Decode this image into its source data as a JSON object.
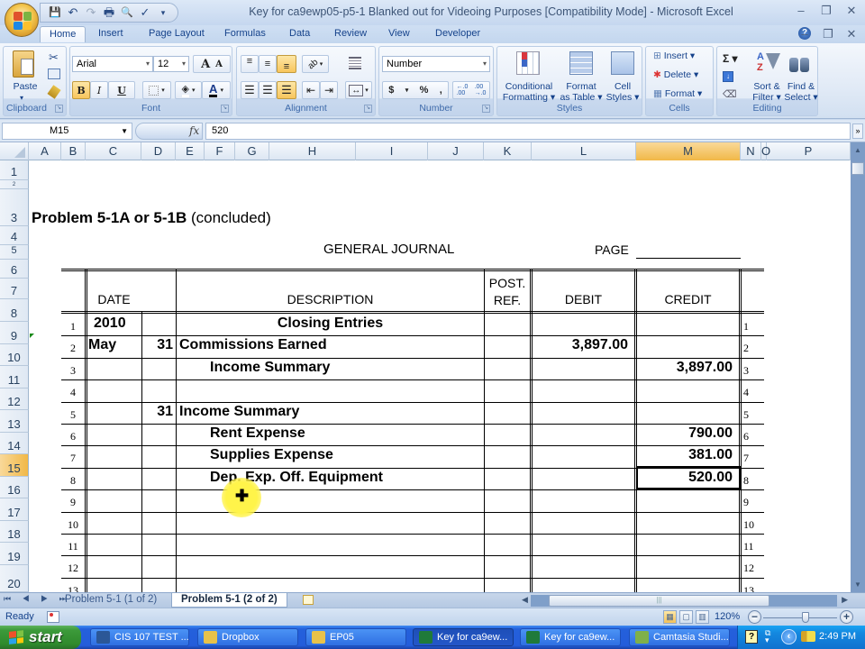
{
  "window": {
    "title": "Key for ca9ewp05-p5-1 Blanked out for Videoing Purposes  [Compatibility Mode] - Microsoft Excel",
    "minimize": "–",
    "restore": "❐",
    "close": "✕"
  },
  "quick_access": {
    "save": "💾",
    "undo": "↶",
    "redo": "↷",
    "print": "🖶",
    "preview": "🔍",
    "spelling": "✓",
    "customize": "▾"
  },
  "tabs": [
    {
      "label": "Home",
      "active": true
    },
    {
      "label": "Insert"
    },
    {
      "label": "Page Layout"
    },
    {
      "label": "Formulas"
    },
    {
      "label": "Data"
    },
    {
      "label": "Review"
    },
    {
      "label": "View"
    },
    {
      "label": "Developer"
    }
  ],
  "ribbon": {
    "clipboard": {
      "label": "Clipboard",
      "paste": "Paste"
    },
    "font": {
      "label": "Font",
      "name": "Arial",
      "size": "12",
      "bold": "B",
      "italic": "I",
      "underline": "U",
      "grow": "A",
      "shrink": "A"
    },
    "alignment": {
      "label": "Alignment"
    },
    "number": {
      "label": "Number",
      "format": "Number",
      "currency": "$",
      "percent": "%",
      "comma": ",",
      "inc_decimal": "←.0 .00",
      "dec_decimal": ".00 →.0"
    },
    "styles": {
      "label": "Styles",
      "conditional_1": "Conditional",
      "conditional_2": "Formatting ▾",
      "format_table_1": "Format",
      "format_table_2": "as Table ▾",
      "cell_styles_1": "Cell",
      "cell_styles_2": "Styles ▾"
    },
    "cells": {
      "label": "Cells",
      "insert": "Insert ▾",
      "delete": "Delete ▾",
      "format": "Format ▾"
    },
    "editing": {
      "label": "Editing",
      "sum": "Σ ▾",
      "sort_1": "Sort &",
      "sort_2": "Filter ▾",
      "find_1": "Find &",
      "find_2": "Select ▾"
    }
  },
  "formula_bar": {
    "name_box": "M15",
    "fx": "fx",
    "value": "520"
  },
  "columns": [
    "A",
    "B",
    "C",
    "D",
    "E",
    "F",
    "G",
    "H",
    "I",
    "J",
    "K",
    "L",
    "M",
    "N",
    "O",
    "P"
  ],
  "selected_column": "M",
  "rows": [
    "1",
    "2",
    "3",
    "4",
    "5",
    "6",
    "7",
    "8",
    "9",
    "10",
    "11",
    "12",
    "13",
    "14",
    "15",
    "16",
    "17",
    "18",
    "19",
    "20"
  ],
  "selected_row": "15",
  "sheet": {
    "title_bold": "Problem 5-1A or 5-1B",
    "title_rest": " (concluded)",
    "journal_title": "GENERAL JOURNAL",
    "page_label": "PAGE",
    "headers": {
      "date": "DATE",
      "description": "DESCRIPTION",
      "post_ref_1": "POST.",
      "post_ref_2": "REF.",
      "debit": "DEBIT",
      "credit": "CREDIT"
    },
    "entries": [
      {
        "line": "1",
        "month": "2010",
        "day": "",
        "description": "Closing Entries",
        "indent": "center",
        "debit": "",
        "credit": ""
      },
      {
        "line": "2",
        "month": "May",
        "day": "31",
        "description": "Commissions Earned",
        "indent": "none",
        "debit": "3,897.00",
        "credit": ""
      },
      {
        "line": "3",
        "month": "",
        "day": "",
        "description": "Income Summary",
        "indent": "indent",
        "debit": "",
        "credit": "3,897.00"
      },
      {
        "line": "4",
        "month": "",
        "day": "",
        "description": "",
        "indent": "none",
        "debit": "",
        "credit": ""
      },
      {
        "line": "5",
        "month": "",
        "day": "31",
        "description": "Income Summary",
        "indent": "none",
        "debit": "",
        "credit": ""
      },
      {
        "line": "6",
        "month": "",
        "day": "",
        "description": "Rent Expense",
        "indent": "indent",
        "debit": "",
        "credit": "790.00"
      },
      {
        "line": "7",
        "month": "",
        "day": "",
        "description": "Supplies Expense",
        "indent": "indent",
        "debit": "",
        "credit": "381.00"
      },
      {
        "line": "8",
        "month": "",
        "day": "",
        "description": "Dep. Exp. Off. Equipment",
        "indent": "indent",
        "debit": "",
        "credit": "520.00"
      },
      {
        "line": "9",
        "month": "",
        "day": "",
        "description": "",
        "indent": "none",
        "debit": "",
        "credit": ""
      },
      {
        "line": "10",
        "month": "",
        "day": "",
        "description": "",
        "indent": "none",
        "debit": "",
        "credit": ""
      },
      {
        "line": "11",
        "month": "",
        "day": "",
        "description": "",
        "indent": "none",
        "debit": "",
        "credit": ""
      },
      {
        "line": "12",
        "month": "",
        "day": "",
        "description": "",
        "indent": "none",
        "debit": "",
        "credit": ""
      },
      {
        "line": "13",
        "month": "",
        "day": "",
        "description": "",
        "indent": "none",
        "debit": "",
        "credit": ""
      }
    ]
  },
  "sheet_tabs": [
    {
      "label": "Problem 5-1 (1 of 2)"
    },
    {
      "label": "Problem 5-1 (2 of 2)",
      "active": true
    }
  ],
  "sheet_nav": "⏮ ◀ ▶ ⏭",
  "status": {
    "mode": "Ready",
    "zoom": "120%",
    "zoom_out": "−",
    "zoom_in": "+"
  },
  "taskbar": {
    "start": "start",
    "items": [
      {
        "label": "CIS 107 TEST ...",
        "icon": "word-icon",
        "color": "#2b5797"
      },
      {
        "label": "Dropbox",
        "icon": "folder-icon",
        "color": "#e8c24a"
      },
      {
        "label": "EP05",
        "icon": "folder-icon",
        "color": "#e8c24a"
      },
      {
        "label": "Key for ca9ew...",
        "icon": "excel-icon",
        "color": "#1f7a3a",
        "active": true
      },
      {
        "label": "Key for ca9ew...",
        "icon": "excel-icon",
        "color": "#1f7a3a"
      },
      {
        "label": "Camtasia Studi...",
        "icon": "camtasia-icon",
        "color": "#7fb04a"
      }
    ],
    "time": "2:49 PM"
  },
  "colors": {
    "accent_selected": "#f1b847",
    "ribbon_text": "#15428b",
    "taskbar_blue": "#245ddb",
    "start_green": "#3c9a3a"
  }
}
